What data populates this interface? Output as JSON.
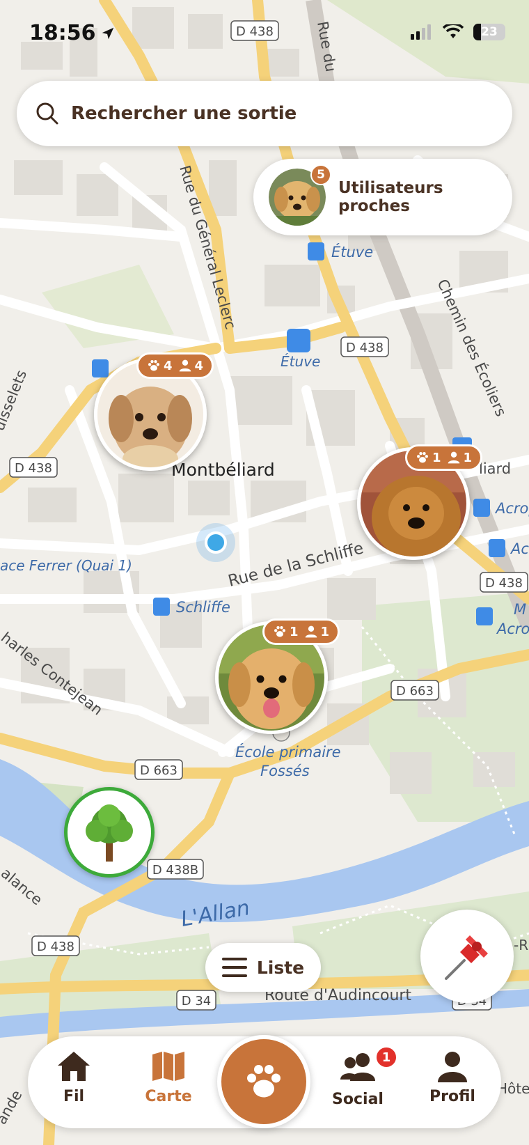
{
  "status_bar": {
    "time": "18:56",
    "battery": "23"
  },
  "search": {
    "placeholder": "Rechercher une sortie"
  },
  "nearby_users": {
    "label": "Utilisateurs proches",
    "count": "5"
  },
  "map": {
    "town_label": "Montbéliard",
    "road_labels": {
      "d438_a": "D 438",
      "d438_b": "D 438",
      "d438_c": "D 438",
      "d438_d": "D 438",
      "d438_e": "D 438",
      "d663_a": "D 663",
      "d663_b": "D 663",
      "d438b": "D 438B",
      "d34_a": "D 34",
      "d34_b": "D 34"
    },
    "street_labels": {
      "rue_general_leclerc": "Rue du Général Leclerc",
      "chemin_ecoliers": "Chemin des Écoliers",
      "rue_schliffe": "Rue de la Schliffe",
      "charles_contejean": "harles Contejean",
      "route_audincourt": "Route d'Audincourt",
      "ruisselets": "uisselets",
      "place_ferrer": "ace Ferrer (Quai 1)",
      "rue_du": "Rue du",
      "lalance": "alance",
      "ande": "ande"
    },
    "poi_labels": {
      "etuve_1": "Étuve",
      "etuve_2": "Étuve",
      "schliffe": "Schliffe",
      "ecole_1": "École primaire",
      "ecole_2": "Fossés",
      "riviere": "L'Allan",
      "acro1": "Acrop",
      "acro2": "Ac",
      "acro3": "M",
      "acro4": "Acro",
      "liard": "liard",
      "hotel": "Hôtel",
      "r": "-R"
    }
  },
  "markers": [
    {
      "paws": "4",
      "people": "4"
    },
    {
      "paws": "1",
      "people": "1"
    },
    {
      "paws": "1",
      "people": "1"
    }
  ],
  "list_button": {
    "label": "Liste"
  },
  "tabs": {
    "fil": "Fil",
    "carte": "Carte",
    "social": "Social",
    "profil": "Profil",
    "social_badge": "1"
  },
  "colors": {
    "accent": "#c8743a",
    "text": "#4a3224",
    "tree_ring": "#3daa3a"
  }
}
